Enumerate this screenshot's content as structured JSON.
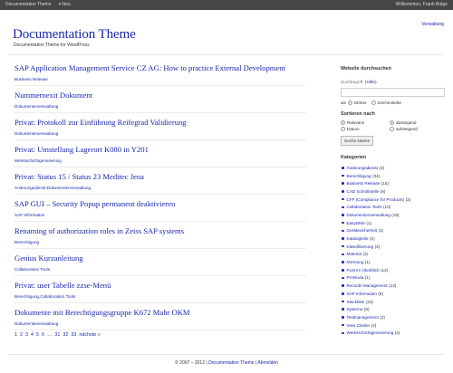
{
  "adminbar": {
    "site_name": "Documentation Theme",
    "new_label": "Neu",
    "welcome": "Willkommen, Frank Bütge"
  },
  "header": {
    "title": "Documentation Theme",
    "description": "Documentation Theme for WordPress",
    "nav_link": "Verwaltung"
  },
  "posts": [
    {
      "title": "SAP Application Management Service CZ AG: How to practice External Development",
      "category": "Business Release"
    },
    {
      "title": "Nummernexit Dokument",
      "category": "Dokumentenverwaltung"
    },
    {
      "title": "Privat: Protokoll zur Einführung Reifegrad Validierung",
      "category": "Dokumentenverwaltung"
    },
    {
      "title": "Privat: Umstellung Lagerort K080 in Y201",
      "category": "Werksschichtgenerierung"
    },
    {
      "title": "Privat: Status 15 / Status 23 Meditec Jena",
      "category": "Änderungsdienst,Dokumentenverwaltung"
    },
    {
      "title": "SAP GUI – Security Popup permanent deaktivieren",
      "category": "SAP Information"
    },
    {
      "title": "Renaming of authorization roles in Zeiss SAP systems",
      "category": "Berechtigung"
    },
    {
      "title": "Genius Kurzanleitung",
      "category": "Collaboration Tools"
    },
    {
      "title": "Privat: user Tabelle zzse-Menü",
      "category": "Berechtigung,Collaboration Tools"
    },
    {
      "title": "Dokumente mit Berechtigungsgruppe K672 Mahr OKM",
      "category": "Dokumentenverwaltung"
    }
  ],
  "pagination": {
    "current": "1",
    "pages": [
      "2",
      "3",
      "4",
      "5",
      "6"
    ],
    "ellipsis": "…",
    "last_pages": [
      "31",
      "32",
      "33"
    ],
    "next": "nächste »"
  },
  "sidebar": {
    "search_heading": "Website durchsuchen",
    "search_label": "Suchbegriff:",
    "help_link": "(Hilfe)",
    "as_label": "als",
    "words_label": "Wörter",
    "phrase_label": "Zeichenkette",
    "sort_heading": "Sortieren nach",
    "sort_relevance": "Relevanz",
    "sort_date": "Datum",
    "sort_desc": "absteigend",
    "sort_asc": "aufsteigend",
    "search_button": "Suche starten",
    "categories_heading": "Kategorien",
    "categories": [
      {
        "name": "Änderungsdienst",
        "count": "(3)"
      },
      {
        "name": "Berechtigung",
        "count": "(34)"
      },
      {
        "name": "Business Release",
        "count": "(15)"
      },
      {
        "name": "CAD Schnittstelle",
        "count": "(9)"
      },
      {
        "name": "CFF (Compliance for Products)",
        "count": "(3)"
      },
      {
        "name": "Collaboration Tools",
        "count": "(10)"
      },
      {
        "name": "Dokumentenverwaltung",
        "count": "(19)"
      },
      {
        "name": "EasyDMS",
        "count": "(1)"
      },
      {
        "name": "Gerätesicherheit",
        "count": "(1)"
      },
      {
        "name": "Katalogteile",
        "count": "(2)"
      },
      {
        "name": "Klassifizierung",
        "count": "(4)"
      },
      {
        "name": "Material",
        "count": "(3)"
      },
      {
        "name": "Normung",
        "count": "(1)"
      },
      {
        "name": "PLM im Überblick",
        "count": "(12)"
      },
      {
        "name": "ProNovia",
        "count": "(1)"
      },
      {
        "name": "Records Management",
        "count": "(13)"
      },
      {
        "name": "SAP Information",
        "count": "(8)"
      },
      {
        "name": "Stückliste",
        "count": "(22)"
      },
      {
        "name": "Systeme",
        "count": "(8)"
      },
      {
        "name": "Testmanagement",
        "count": "(3)"
      },
      {
        "name": "View Cluster",
        "count": "(2)"
      },
      {
        "name": "Werksschichtgenerierung",
        "count": "(4)"
      }
    ]
  },
  "footer": {
    "copyright": "© 2007 – 2012",
    "theme_link": "Documentation Theme",
    "logout_link": "Abmelden"
  },
  "colors": {
    "link": "#1a27a8",
    "adminbar": "#464646"
  }
}
